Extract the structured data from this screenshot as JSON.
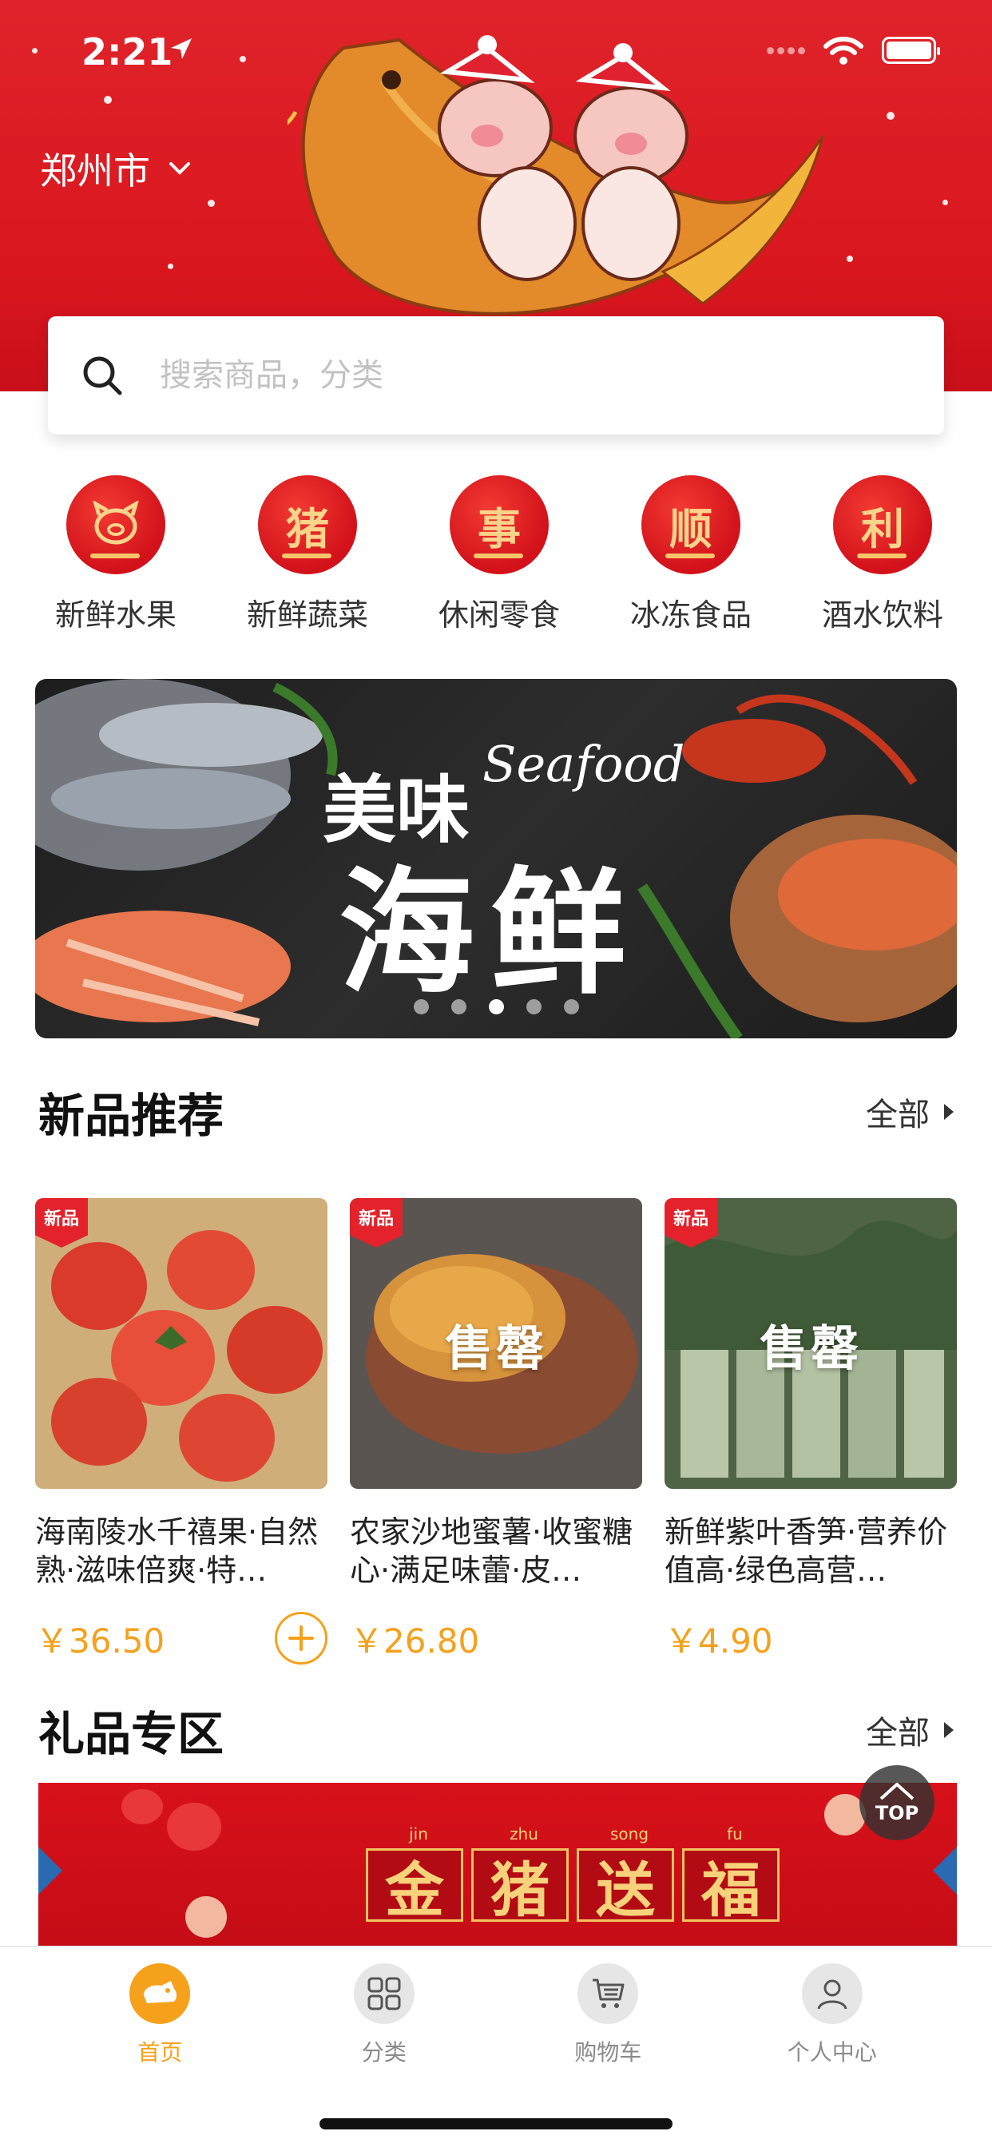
{
  "status": {
    "time": "2:21"
  },
  "header": {
    "city": "郑州市"
  },
  "search": {
    "placeholder": "搜索商品，分类"
  },
  "categories": [
    {
      "label": "新鲜水果",
      "icon": "pig-icon",
      "char": ""
    },
    {
      "label": "新鲜蔬菜",
      "icon": "zhu-badge-icon",
      "char": "猪"
    },
    {
      "label": "休闲零食",
      "icon": "shi-badge-icon",
      "char": "事"
    },
    {
      "label": "冰冻食品",
      "icon": "shun-badge-icon",
      "char": "顺"
    },
    {
      "label": "酒水饮料",
      "icon": "li-badge-icon",
      "char": "利"
    }
  ],
  "banner": {
    "title_cn": "美味",
    "title_en": "Seafood",
    "title_big": "海鲜",
    "slide_count": 5,
    "active_slide": 3
  },
  "new_products": {
    "title": "新品推荐",
    "more": "全部",
    "items": [
      {
        "tag": "新品",
        "name": "海南陵水千禧果·自然熟·滋味倍爽·特…",
        "price": "￥36.50",
        "sold_out": "",
        "image": "tomatoes",
        "colors": [
          "#c8a46c",
          "#d93a2b"
        ]
      },
      {
        "tag": "新品",
        "name": "农家沙地蜜薯·收蜜糖心·满足味蕾·皮…",
        "price": "￥26.80",
        "sold_out": "售罄",
        "image": "sweet-potato",
        "colors": [
          "#6b4b3a",
          "#c98a3a"
        ]
      },
      {
        "tag": "新品",
        "name": " 新鲜紫叶香笋·营养价值高·绿色高营…",
        "price": "￥4.90",
        "sold_out": "售罄",
        "image": "lettuce-stems",
        "colors": [
          "#4f6a45",
          "#a9b79a"
        ]
      }
    ]
  },
  "gifts": {
    "title": "礼品专区",
    "more": "全部",
    "banner_pinyin": [
      "jin",
      "zhu",
      "song",
      "fu"
    ],
    "banner_chars": [
      "金",
      "猪",
      "送",
      "福"
    ]
  },
  "top_button": "TOP",
  "tabbar": [
    {
      "label": "首页",
      "icon": "home-icon",
      "active": true
    },
    {
      "label": "分类",
      "icon": "category-grid-icon",
      "active": false
    },
    {
      "label": "购物车",
      "icon": "cart-icon",
      "active": false
    },
    {
      "label": "个人中心",
      "icon": "user-icon",
      "active": false
    }
  ],
  "colors": {
    "brand_red": "#e0232a",
    "accent_orange": "#f5a11c"
  }
}
